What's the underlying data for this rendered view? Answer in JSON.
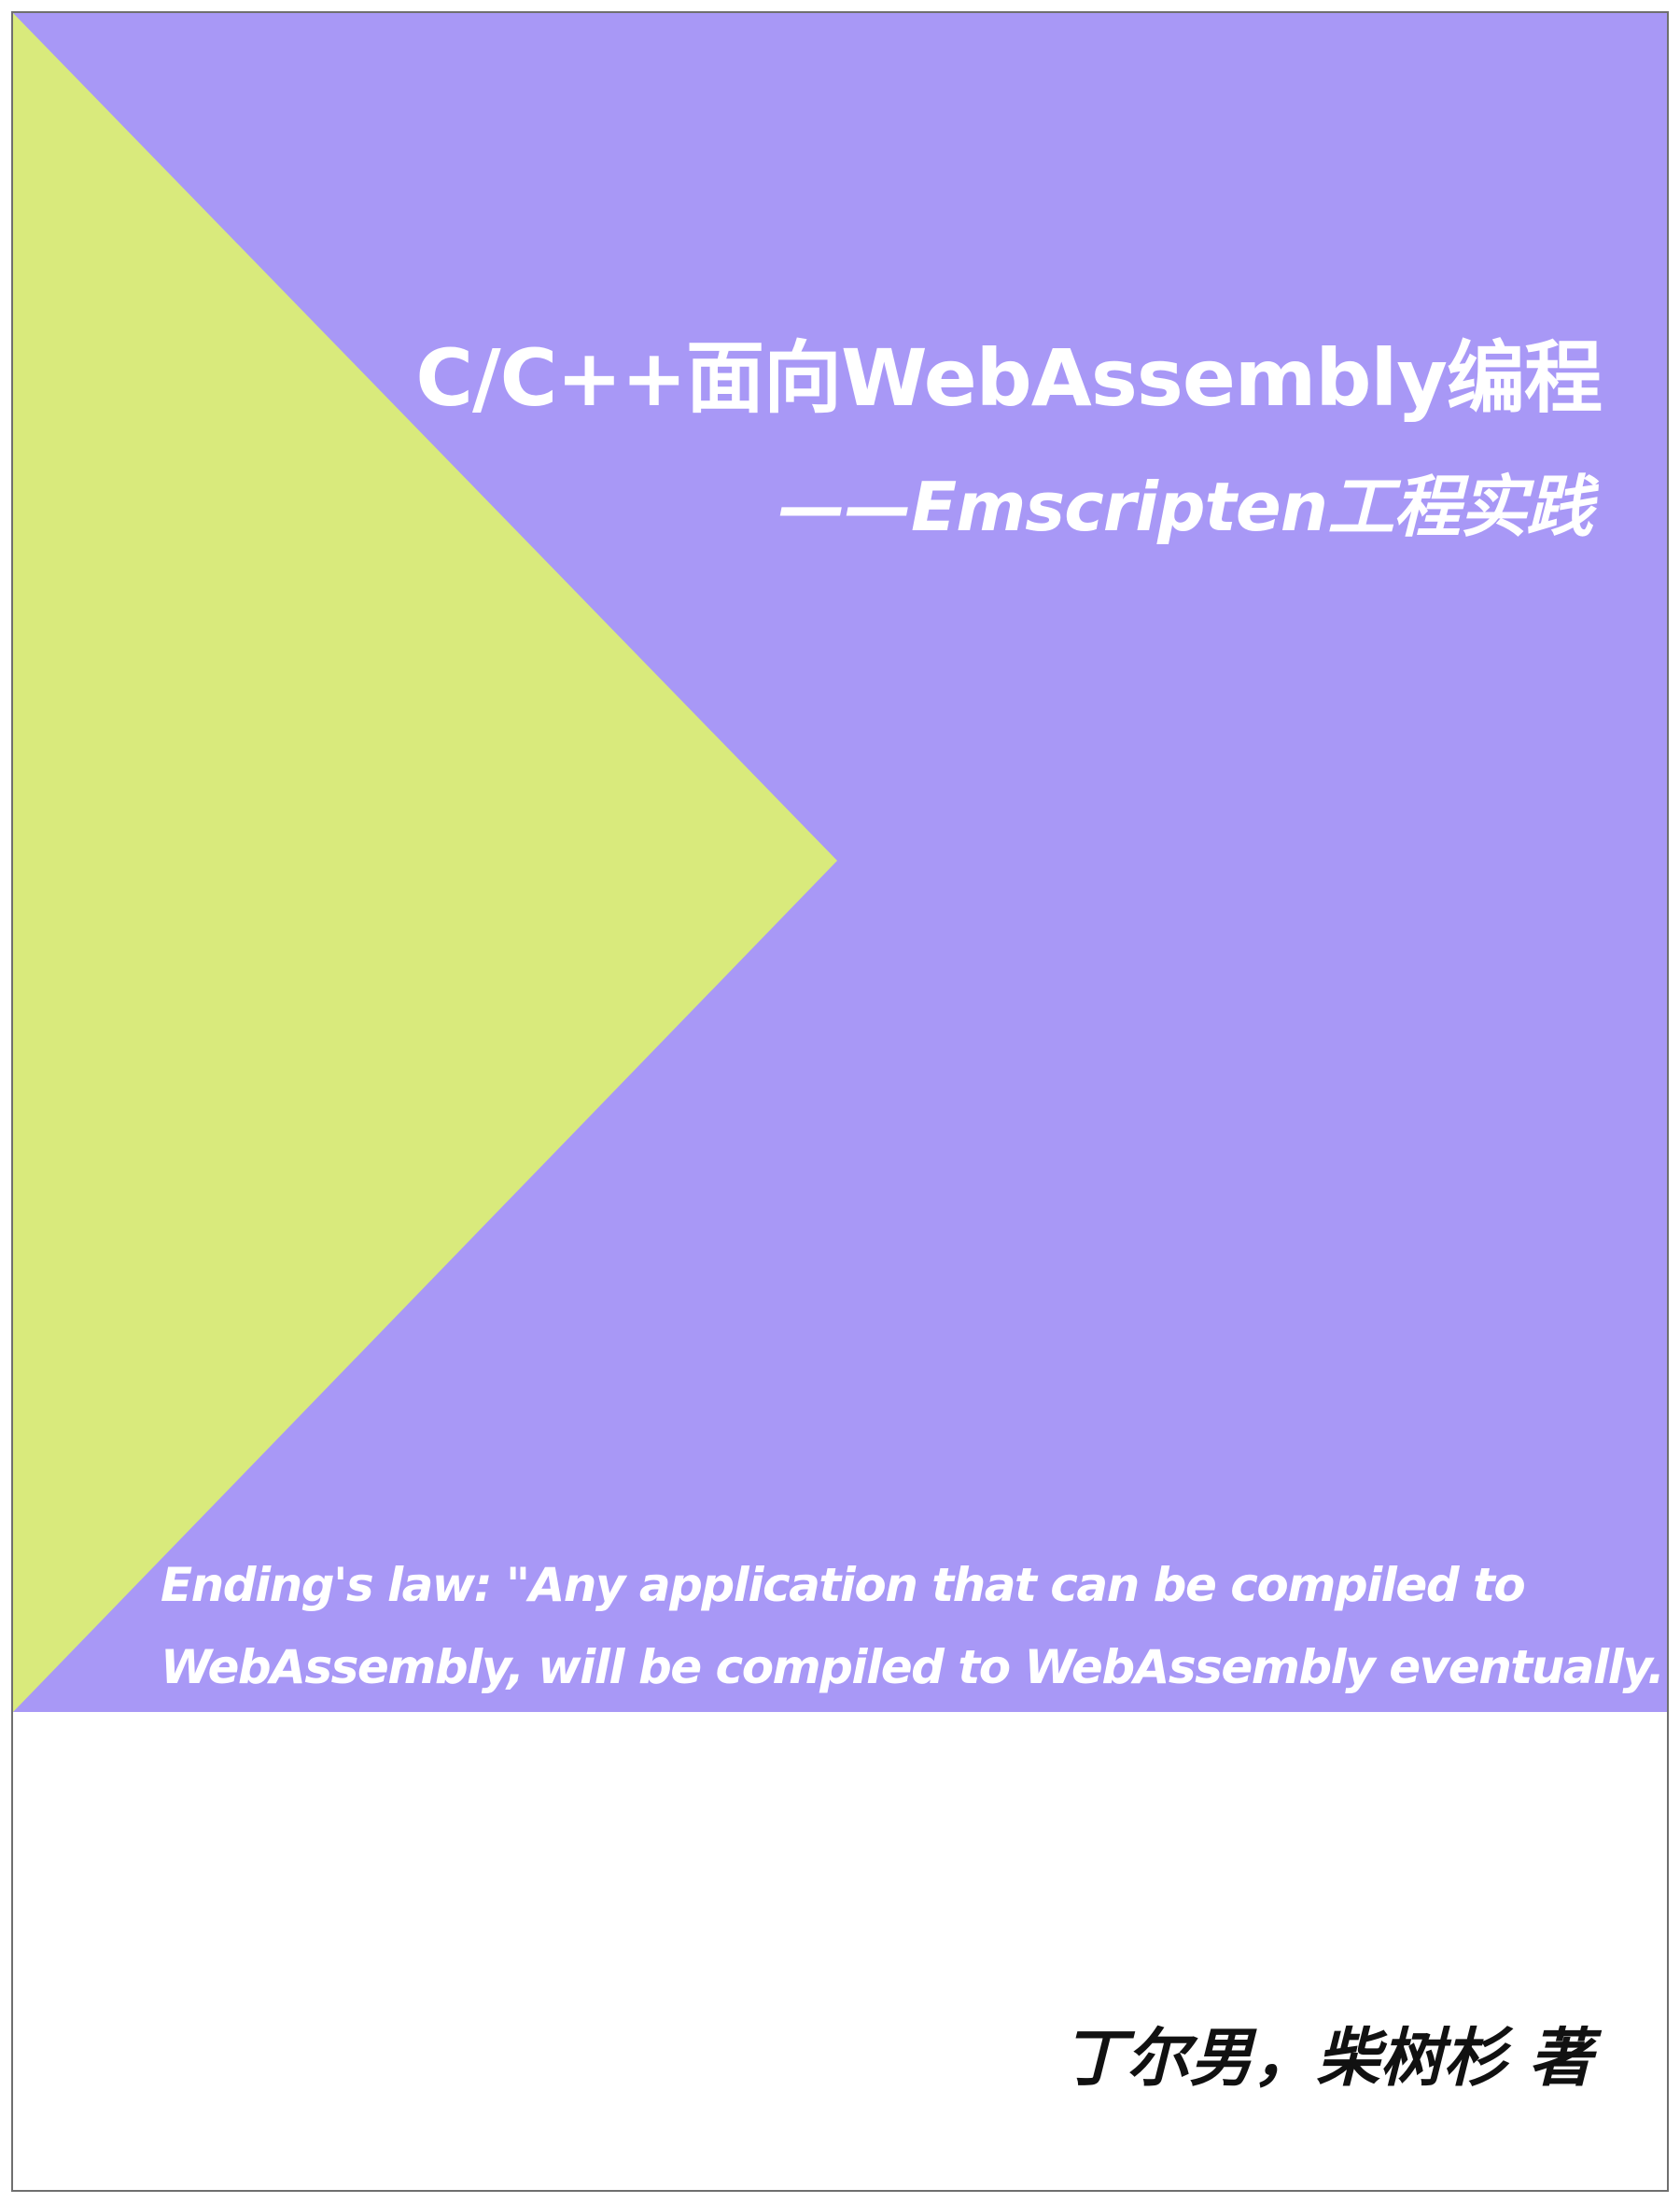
{
  "cover": {
    "title": "C/C++面向WebAssembly编程",
    "subtitle": "——Emscripten工程实践",
    "quote_line1": "Ending's law: \"Any application that can be compiled to",
    "quote_line2": "WebAssembly, will be compiled to WebAssembly eventually.\"",
    "authors": "丁尔男，柴树杉 著"
  },
  "colors": {
    "band": "#a898f6",
    "triangle": "#d9ea7c",
    "text_light": "#ffffff",
    "text_dark": "#111111",
    "border": "#6f6f6f"
  }
}
